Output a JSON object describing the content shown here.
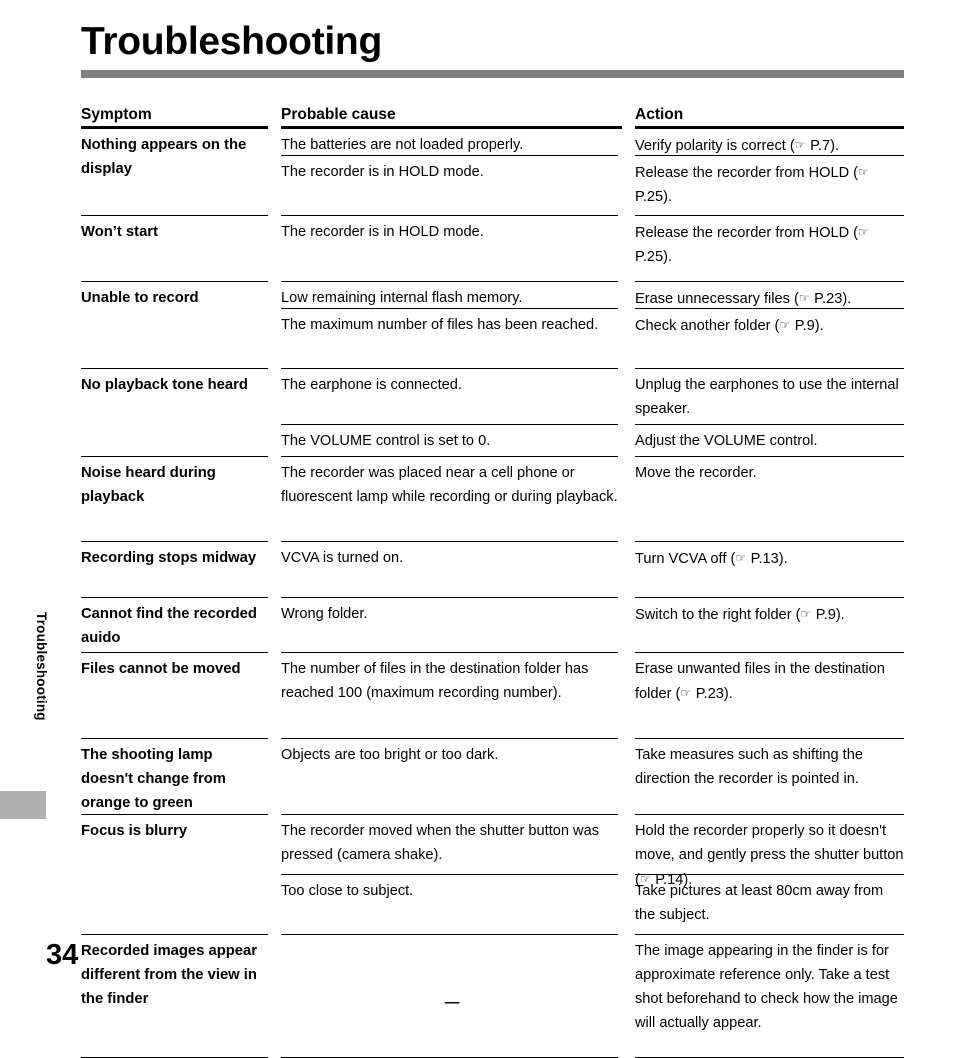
{
  "page": {
    "title": "Troubleshooting",
    "side_tab_label": "Troubleshooting",
    "page_number": "34"
  },
  "table": {
    "headers": {
      "symptom": "Symptom",
      "cause": "Probable cause",
      "action": "Action"
    },
    "hand_icon": "☞",
    "rows": [
      {
        "symptom": "Nothing appears on the display",
        "entries": [
          {
            "cause": "The batteries are not loaded properly.",
            "action_pre": "Verify polarity is correct (",
            "action_post": " P.7)."
          },
          {
            "cause": "The recorder is in HOLD mode.",
            "action_pre": "Release the recorder from HOLD (",
            "action_post": " P.25)."
          }
        ]
      },
      {
        "symptom": "Won’t start",
        "entries": [
          {
            "cause": "The recorder is in HOLD mode.",
            "action_pre": "Release the recorder from HOLD (",
            "action_post": " P.25)."
          }
        ]
      },
      {
        "symptom": "Unable to record",
        "entries": [
          {
            "cause": "Low remaining internal flash memory.",
            "action_pre": "Erase unnecessary files (",
            "action_post": " P.23)."
          },
          {
            "cause": "The maximum number of files has been reached.",
            "action_pre": "Check another folder (",
            "action_post": " P.9)."
          }
        ]
      },
      {
        "symptom": "No playback tone heard",
        "entries": [
          {
            "cause": "The earphone is connected.",
            "action_pre": "Unplug the earphones to use the internal speaker.",
            "action_post": ""
          },
          {
            "cause": "The VOLUME control is set to 0.",
            "action_pre": "Adjust the VOLUME control.",
            "action_post": ""
          }
        ]
      },
      {
        "symptom": "Noise heard during playback",
        "entries": [
          {
            "cause": "The recorder was placed near a cell phone or fluorescent lamp while recording or during playback.",
            "action_pre": "Move the recorder.",
            "action_post": ""
          }
        ]
      },
      {
        "symptom": "Recording stops midway",
        "entries": [
          {
            "cause": "VCVA is turned on.",
            "action_pre": "Turn VCVA off (",
            "action_post": " P.13)."
          }
        ]
      },
      {
        "symptom": "Cannot find the recorded auido",
        "entries": [
          {
            "cause": "Wrong folder.",
            "action_pre": "Switch to the right folder (",
            "action_post": " P.9)."
          }
        ]
      },
      {
        "symptom": "Files cannot be moved",
        "entries": [
          {
            "cause": "The number of files in the destination folder has reached 100 (maximum recording number).",
            "action_pre": "Erase unwanted files in the destination folder (",
            "action_post": " P.23)."
          }
        ]
      },
      {
        "symptom": "The shooting lamp doesn't change from orange to green",
        "entries": [
          {
            "cause": "Objects are too bright or too dark.",
            "action_pre": "Take measures such as shifting the direction the recorder is pointed in.",
            "action_post": ""
          }
        ]
      },
      {
        "symptom": "Focus is blurry",
        "entries": [
          {
            "cause": "The recorder moved when the shutter button was pressed (camera shake).",
            "action_pre": "Hold the recorder properly so it doesn't move, and gently press the shutter button (",
            "action_post": " P.14)."
          },
          {
            "cause": "Too close to subject.",
            "action_pre": "Take pictures at least 80cm away from the subject.",
            "action_post": ""
          }
        ]
      },
      {
        "symptom": "Recorded images appear different from the view in the finder",
        "entries": [
          {
            "cause": "—",
            "action_pre": "The image appearing in the finder is for approximate reference only. Take a test shot beforehand to check how the image will actually appear.",
            "action_post": ""
          }
        ]
      }
    ]
  }
}
